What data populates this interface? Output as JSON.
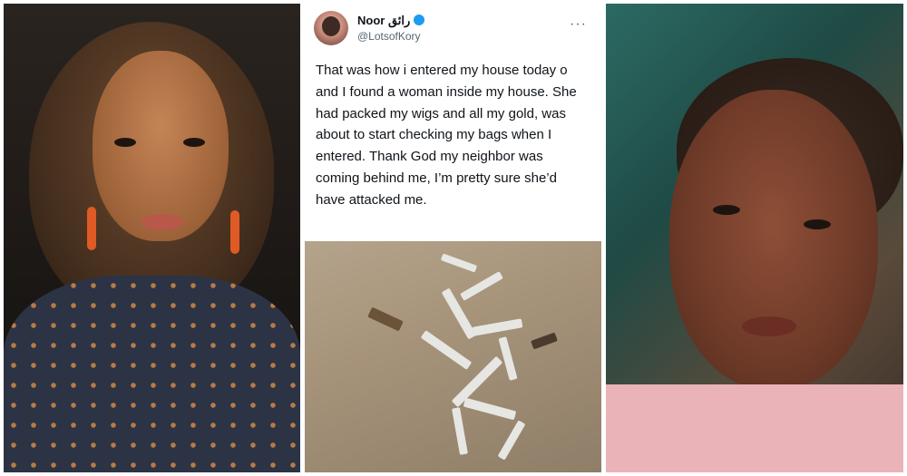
{
  "tweet": {
    "display_name": "Noor رائق",
    "handle": "@LotsofKory",
    "more_glyph": "···",
    "text": "That was how i entered my house today o and I found a woman inside my house. She had packed my wigs and all my gold, was about to start checking my bags when I entered. Thank God my neighbor was coming behind me, I’m pretty sure she’d have attacked me."
  },
  "colors": {
    "verified_badge": "#1d9bf0",
    "earring": "#e05a25",
    "shirt_left": "#2b3344",
    "shirt_right": "#e9b3b7"
  }
}
